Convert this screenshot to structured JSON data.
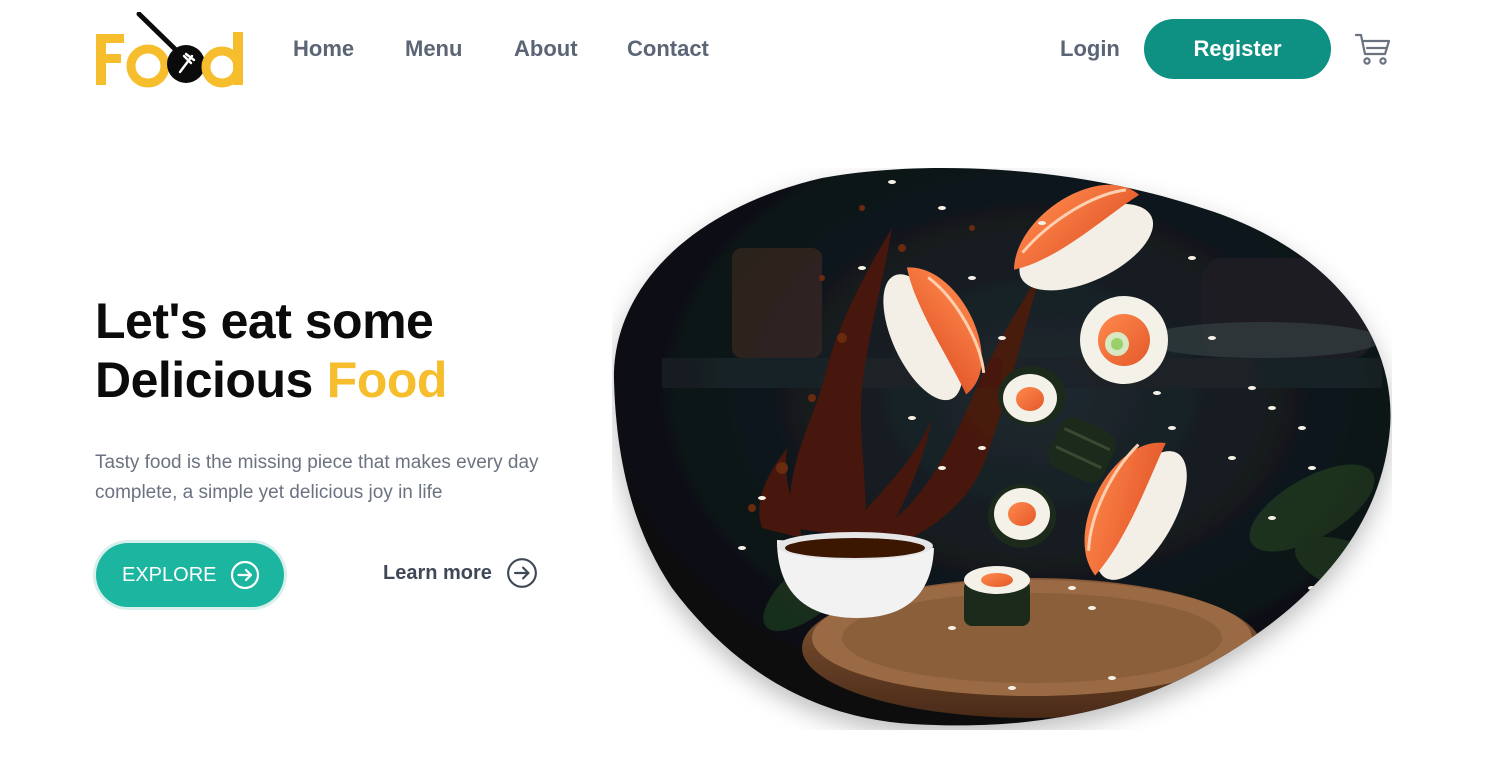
{
  "brand": {
    "logo_text": "Food",
    "colors": {
      "accent": "#f6bd2c",
      "teal_dark": "#0e9183",
      "teal": "#1bb5a0",
      "nav_text": "#5b6575"
    }
  },
  "nav": {
    "items": [
      {
        "label": "Home"
      },
      {
        "label": "Menu"
      },
      {
        "label": "About"
      },
      {
        "label": "Contact"
      }
    ],
    "login_label": "Login",
    "register_label": "Register",
    "cart_icon": "cart-icon"
  },
  "hero": {
    "headline_line1": "Let's eat some",
    "headline_line2": "Delicious",
    "headline_accent": "Food",
    "description": "Tasty food is the missing piece that makes every day complete, a simple yet delicious joy in life",
    "explore_label": "EXPLORE",
    "learn_more_label": "Learn more",
    "image_subject": "flying sushi with soy sauce splash"
  }
}
